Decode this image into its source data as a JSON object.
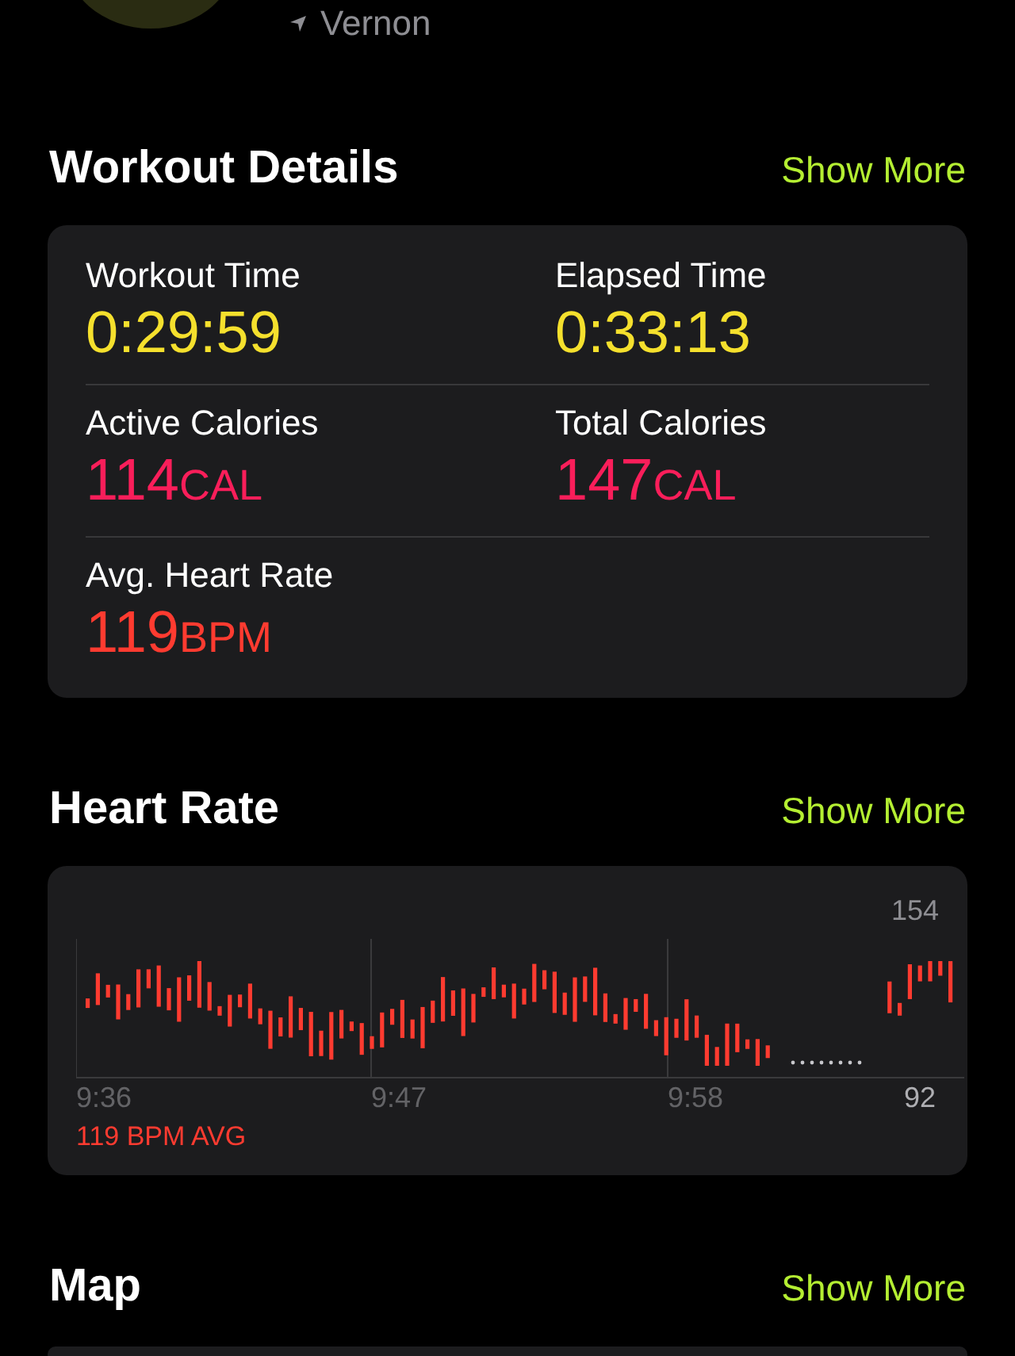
{
  "location": {
    "name": "Vernon"
  },
  "workout_details": {
    "title": "Workout Details",
    "action": "Show More",
    "metrics": [
      {
        "label": "Workout Time",
        "value": "0:29:59",
        "color": "#f5e02d"
      },
      {
        "label": "Elapsed Time",
        "value": "0:33:13",
        "color": "#f5e02d"
      },
      {
        "label": "Active Calories",
        "value": "114",
        "unit": "CAL",
        "color": "#fa1e5a"
      },
      {
        "label": "Total Calories",
        "value": "147",
        "unit": "CAL",
        "color": "#fa1e5a"
      },
      {
        "label": "Avg. Heart Rate",
        "value": "119",
        "unit": "BPM",
        "color": "#ff3b30"
      }
    ]
  },
  "heart_rate": {
    "title": "Heart Rate",
    "action": "Show More",
    "max": "154",
    "min": "92",
    "times": [
      "9:36",
      "9:47",
      "9:58"
    ],
    "average": "119 BPM AVG"
  },
  "map": {
    "title": "Map",
    "action": "Show More"
  }
}
